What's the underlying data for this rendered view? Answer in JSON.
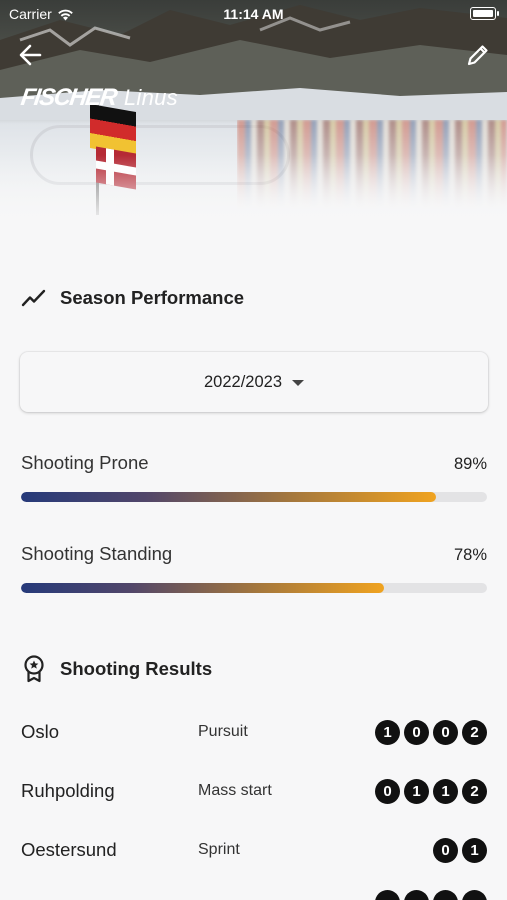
{
  "status_bar": {
    "carrier": "Carrier",
    "time": "11:14 AM"
  },
  "header": {
    "brand": "FISCHER",
    "athlete_name": "Linus"
  },
  "season_performance": {
    "title": "Season Performance",
    "selected_season": "2022/2023",
    "metrics": [
      {
        "label": "Shooting Prone",
        "value": "89%",
        "fraction": 0.89
      },
      {
        "label": "Shooting Standing",
        "value": "78%",
        "fraction": 0.78
      }
    ]
  },
  "shooting_results": {
    "title": "Shooting Results",
    "rows": [
      {
        "place": "Oslo",
        "type": "Pursuit",
        "shots": [
          "1",
          "0",
          "0",
          "2"
        ]
      },
      {
        "place": "Ruhpolding",
        "type": "Mass start",
        "shots": [
          "0",
          "1",
          "1",
          "2"
        ]
      },
      {
        "place": "Oestersund",
        "type": "Sprint",
        "shots": [
          "0",
          "1"
        ]
      }
    ]
  },
  "colors": {
    "bar_start": "#263a7a",
    "bar_end": "#f0a320",
    "track": "#e3e3e5",
    "shot_badge": "#111111"
  }
}
